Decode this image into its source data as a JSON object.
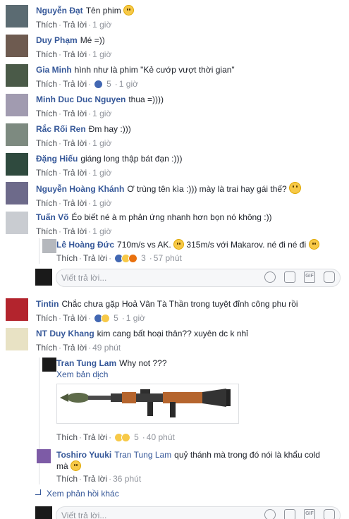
{
  "labels": {
    "like": "Thích",
    "reply": "Trả lời",
    "sep": "·",
    "reply_placeholder": "Viết trả lời...",
    "translate": "Xem bản dịch",
    "more_replies": "Xem phản hồi khác"
  },
  "comments": [
    {
      "name": "Nguyễn Đạt",
      "text": "Tên phim",
      "time": "1 giờ"
    },
    {
      "name": "Duy Phạm",
      "text": "Mé =))",
      "time": "1 giờ"
    },
    {
      "name": "Gia Minh",
      "text": "hình như là phim \"Kẻ cướp vượt thời gian\"",
      "reactions": "5",
      "time": "1 giờ"
    },
    {
      "name": "Minh Duc Duc Nguyen",
      "text": "thua =))))",
      "time": "1 giờ"
    },
    {
      "name": "Rắc Rối Ren",
      "text": "Đm hay :)))",
      "time": "1 giờ"
    },
    {
      "name": "Đặng Hiếu",
      "text": "giáng long thập bát đạn :)))",
      "time": "1 giờ"
    },
    {
      "name": "Nguyễn Hoàng Khánh",
      "text": "Ơ trùng tên kìa :))) mày là trai hay gái thế?",
      "time": "1 giờ"
    },
    {
      "name": "Tuấn Võ",
      "text": "Éo biết né à m phản ứng nhanh hơn bọn nó không :))",
      "time": "1 giờ"
    },
    {
      "name": "Tintin",
      "text": "Chắc chưa gặp Hoả Vân Tà Thần trong tuyệt đỉnh công phu rồi",
      "reactions": "5",
      "time": "1 giờ"
    },
    {
      "name": "NT Duy Khang",
      "text": "kim cang bất hoại thân?? xuyên dc k nhỉ",
      "time": "49 phút"
    }
  ],
  "replies": [
    {
      "name": "Lê Hoàng Đức",
      "text_a": "710m/s vs AK.",
      "text_b": "315m/s với Makarov. né đi né đi",
      "reactions": "3",
      "time": "57 phút"
    },
    {
      "name": "Tran Tung Lam",
      "text": "Why not ???",
      "reactions": "5",
      "time": "40 phút"
    },
    {
      "name": "Toshiro Yuuki",
      "tag": "Tran Tung Lam",
      "text_a": "quỷ thánh mà trong đó nói là khẩu cold",
      "text_b": "mà",
      "time": "36 phút"
    }
  ],
  "colors": {
    "name": "#365899",
    "meta": "#90949c",
    "text": "#1d2129",
    "border": "#dddfe2"
  },
  "icons": [
    "smile-icon",
    "camera-icon",
    "gif-icon",
    "sticker-icon",
    "reply-arrow-icon"
  ]
}
